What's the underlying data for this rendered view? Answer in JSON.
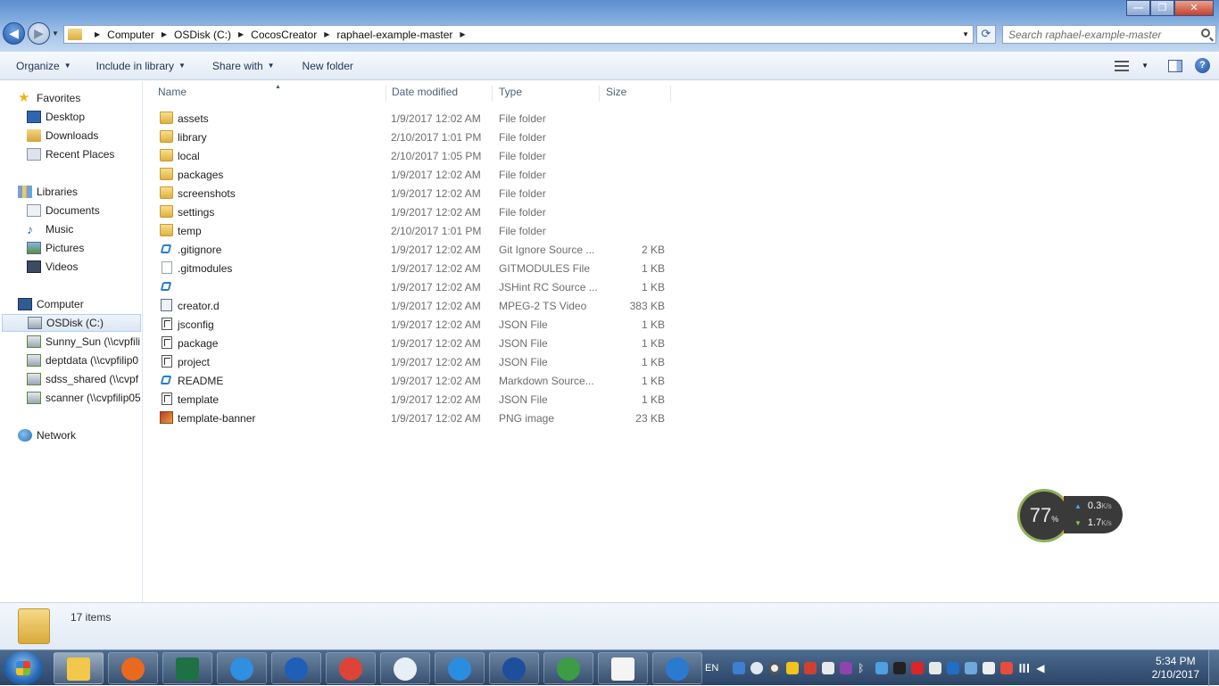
{
  "window": {
    "minimize": "—",
    "maximize": "❐",
    "close": "✕"
  },
  "address": {
    "crumbs": [
      "Computer",
      "OSDisk (C:)",
      "CocosCreator",
      "raphael-example-master"
    ],
    "search_placeholder": "Search raphael-example-master"
  },
  "toolbar": {
    "organize": "Organize",
    "include_in_library": "Include in library",
    "share_with": "Share with",
    "new_folder": "New folder"
  },
  "nav": {
    "favorites": "Favorites",
    "desktop": "Desktop",
    "downloads": "Downloads",
    "recent_places": "Recent Places",
    "libraries": "Libraries",
    "documents": "Documents",
    "music": "Music",
    "pictures": "Pictures",
    "videos": "Videos",
    "computer": "Computer",
    "osdisk": "OSDisk (C:)",
    "drive_sunny": "Sunny_Sun (\\\\cvpfili",
    "drive_deptdata": "deptdata (\\\\cvpfilip0",
    "drive_sdss": "sdss_shared (\\\\cvpf",
    "drive_scanner": "scanner (\\\\cvpfilip05",
    "network": "Network"
  },
  "columns": {
    "name": "Name",
    "date": "Date modified",
    "type": "Type",
    "size": "Size"
  },
  "files": [
    {
      "name": "assets",
      "date": "1/9/2017 12:02 AM",
      "type": "File folder",
      "size": "",
      "icon": "folder-icon"
    },
    {
      "name": "library",
      "date": "2/10/2017 1:01 PM",
      "type": "File folder",
      "size": "",
      "icon": "folder-icon"
    },
    {
      "name": "local",
      "date": "2/10/2017 1:05 PM",
      "type": "File folder",
      "size": "",
      "icon": "folder-icon"
    },
    {
      "name": "packages",
      "date": "1/9/2017 12:02 AM",
      "type": "File folder",
      "size": "",
      "icon": "folder-icon"
    },
    {
      "name": "screenshots",
      "date": "1/9/2017 12:02 AM",
      "type": "File folder",
      "size": "",
      "icon": "folder-icon"
    },
    {
      "name": "settings",
      "date": "1/9/2017 12:02 AM",
      "type": "File folder",
      "size": "",
      "icon": "folder-icon"
    },
    {
      "name": "temp",
      "date": "2/10/2017 1:01 PM",
      "type": "File folder",
      "size": "",
      "icon": "folder-icon"
    },
    {
      "name": ".gitignore",
      "date": "1/9/2017 12:02 AM",
      "type": "Git Ignore Source ...",
      "size": "2 KB",
      "icon": "vscode-icon"
    },
    {
      "name": ".gitmodules",
      "date": "1/9/2017 12:02 AM",
      "type": "GITMODULES File",
      "size": "1 KB",
      "icon": "document-icon"
    },
    {
      "name": "",
      "date": "1/9/2017 12:02 AM",
      "type": "JSHint RC Source ...",
      "size": "1 KB",
      "icon": "vscode-icon"
    },
    {
      "name": "creator.d",
      "date": "1/9/2017 12:02 AM",
      "type": "MPEG-2 TS Video",
      "size": "383 KB",
      "icon": "video-icon"
    },
    {
      "name": "jsconfig",
      "date": "1/9/2017 12:02 AM",
      "type": "JSON File",
      "size": "1 KB",
      "icon": "json-icon"
    },
    {
      "name": "package",
      "date": "1/9/2017 12:02 AM",
      "type": "JSON File",
      "size": "1 KB",
      "icon": "json-icon"
    },
    {
      "name": "project",
      "date": "1/9/2017 12:02 AM",
      "type": "JSON File",
      "size": "1 KB",
      "icon": "json-icon"
    },
    {
      "name": "README",
      "date": "1/9/2017 12:02 AM",
      "type": "Markdown Source...",
      "size": "1 KB",
      "icon": "vscode-icon"
    },
    {
      "name": "template",
      "date": "1/9/2017 12:02 AM",
      "type": "JSON File",
      "size": "1 KB",
      "icon": "json-icon"
    },
    {
      "name": "template-banner",
      "date": "1/9/2017 12:02 AM",
      "type": "PNG image",
      "size": "23 KB",
      "icon": "png-icon"
    }
  ],
  "network_widget": {
    "percent": "77",
    "percent_sign": "%",
    "up": "0.3",
    "down": "1.7",
    "unit": "K/s"
  },
  "details": {
    "count": "17 items"
  },
  "taskbar": {
    "apps": [
      "file-explorer-icon",
      "media-player-icon",
      "excel-icon",
      "app-g-icon",
      "cloud-app-icon",
      "chrome-icon",
      "drop-app-icon",
      "internet-explorer-icon",
      "app-arrow-icon",
      "green-app-icon",
      "chart-app-icon",
      "vscode-icon"
    ],
    "language": "EN",
    "time": "5:34 PM",
    "date": "2/10/2017"
  },
  "colors": {
    "folder": "#e0b042",
    "taskbar": "#2b4566",
    "accent": "#1f58b0"
  }
}
